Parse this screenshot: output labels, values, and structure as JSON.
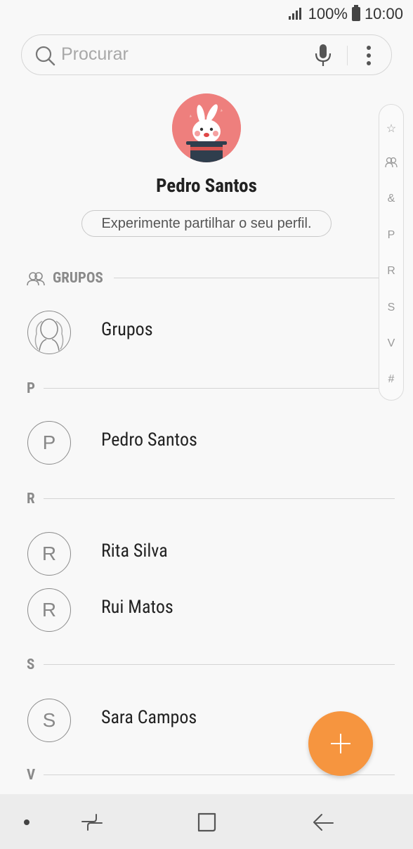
{
  "status_bar": {
    "battery": "100%",
    "time": "10:00"
  },
  "search": {
    "placeholder": "Procurar"
  },
  "profile": {
    "name": "Pedro Santos",
    "share_text": "Experimente partilhar o seu perfil."
  },
  "groups_section": {
    "label": "GRUPOS",
    "item": "Grupos"
  },
  "sections": [
    {
      "letter": "P",
      "contacts": [
        {
          "initial": "P",
          "name": "Pedro Santos"
        }
      ]
    },
    {
      "letter": "R",
      "contacts": [
        {
          "initial": "R",
          "name": "Rita Silva"
        },
        {
          "initial": "R",
          "name": "Rui Matos"
        }
      ]
    },
    {
      "letter": "S",
      "contacts": [
        {
          "initial": "S",
          "name": "Sara Campos"
        }
      ]
    },
    {
      "letter": "V",
      "contacts": []
    }
  ],
  "index_rail": [
    "☆",
    "group",
    "&",
    "P",
    "R",
    "S",
    "V",
    "#"
  ],
  "colors": {
    "accent": "#f6953f",
    "avatar_bg": "#ee7f7d"
  }
}
